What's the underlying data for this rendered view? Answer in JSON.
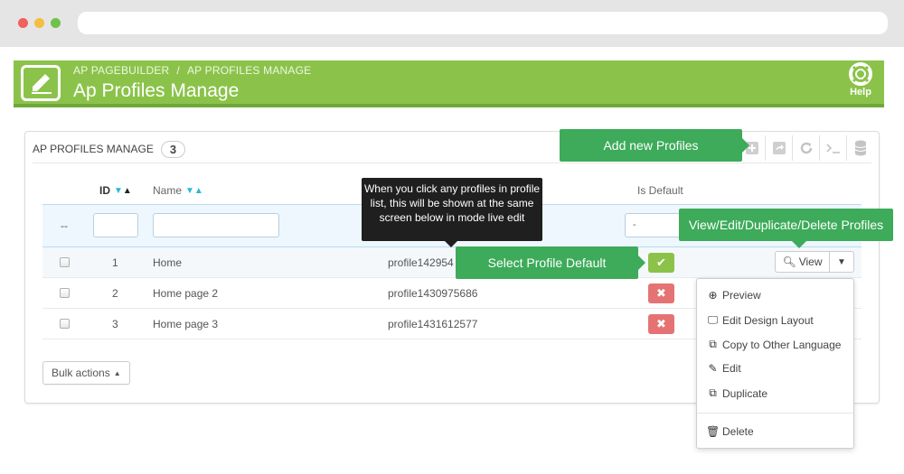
{
  "header": {
    "breadcrumb": [
      "AP PAGEBUILDER",
      "AP PROFILES MANAGE"
    ],
    "breadcrumb_separator": "/",
    "title": "Ap Profiles Manage",
    "help_label": "Help",
    "accent_color": "#8bc34a"
  },
  "panel": {
    "title": "AP PROFILES MANAGE",
    "count": "3",
    "toolbar_icons": [
      "add-icon",
      "export-icon",
      "refresh-icon",
      "terminal-icon",
      "database-icon"
    ]
  },
  "table": {
    "columns": {
      "id": "ID",
      "name": "Name",
      "profile_key": "",
      "is_default": "Is Default"
    },
    "filter": {
      "dashes": "--",
      "id_value": "",
      "name_value": "",
      "is_default_value": "-"
    },
    "rows": [
      {
        "id": "1",
        "name": "Home",
        "profile_key": "profile142954",
        "is_default": true
      },
      {
        "id": "2",
        "name": "Home page 2",
        "profile_key": "profile1430975686",
        "is_default": false
      },
      {
        "id": "3",
        "name": "Home page 3",
        "profile_key": "profile1431612577",
        "is_default": false
      }
    ],
    "view_label": "View"
  },
  "bulk_label": "Bulk actions",
  "dropdown": {
    "items": [
      "Preview",
      "Edit Design Layout",
      "Copy to Other Language",
      "Edit",
      "Duplicate"
    ],
    "delete_label": "Delete"
  },
  "callouts": {
    "add_profiles": "Add new Profiles",
    "select_default": "Select Profile Default",
    "view_edit": "View/Edit/Duplicate/Delete Profiles",
    "tooltip": "When you click any profiles in profile list, this will be shown at the same screen below in mode live edit"
  }
}
